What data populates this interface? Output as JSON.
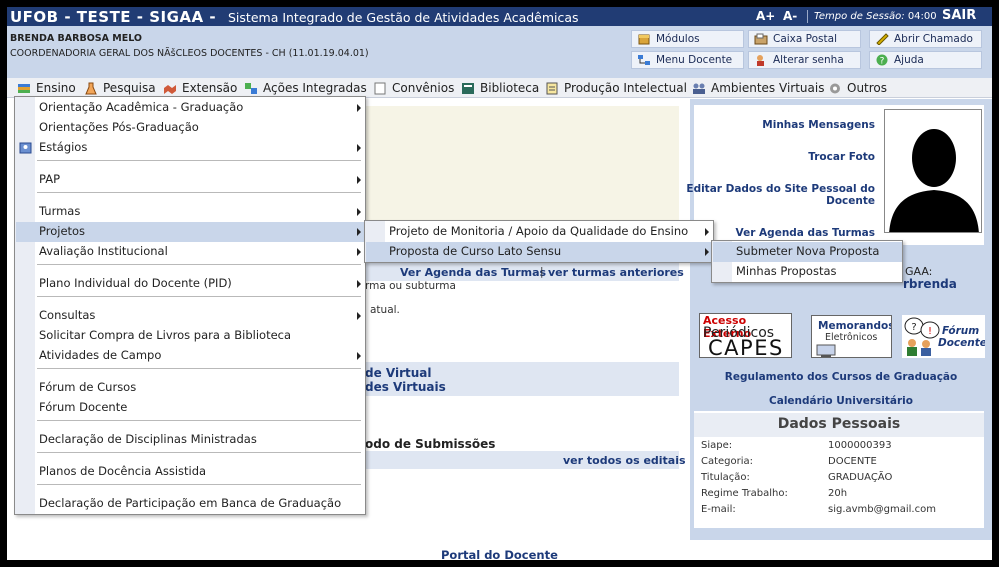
{
  "topbar": {
    "brand": "UFOB - TESTE - SIGAA -",
    "system_name": "Sistema Integrado de Gestão de Atividades Acadêmicas",
    "font_increase": "A+",
    "font_decrease": "A-",
    "session_label": "Tempo de Sessão:",
    "session_time": "04:00",
    "logout": "SAIR"
  },
  "user": {
    "name": "BRENDA BARBOSA MELO",
    "unit": "COORDENADORIA GERAL DOS NÃšCLEOS DOCENTES - CH (11.01.19.04.01)"
  },
  "shortcuts": {
    "modulos": "Módulos",
    "caixa_postal": "Caixa Postal",
    "abrir_chamado": "Abrir Chamado",
    "menu_docente": "Menu Docente",
    "alterar_senha": "Alterar senha",
    "ajuda": "Ajuda"
  },
  "menu": {
    "ensino": "Ensino",
    "pesquisa": "Pesquisa",
    "extensao": "Extensão",
    "acoes": "Ações Integradas",
    "convenios": "Convênios",
    "biblioteca": "Biblioteca",
    "producao": "Produção Intelectual",
    "ambientes": "Ambientes Virtuais",
    "outros": "Outros"
  },
  "ensino_menu": [
    "Orientação Acadêmica - Graduação",
    "Orientações Pós-Graduação",
    "Estágios",
    "PAP",
    "Turmas",
    "Projetos",
    "Avaliação Institucional",
    "Plano Individual do Docente (PID)",
    "Consultas",
    "Solicitar Compra de Livros para a Biblioteca",
    "Atividades de Campo",
    "Fórum de Cursos",
    "Fórum Docente",
    "Declaração de Disciplinas Ministradas",
    "Planos de Docência Assistida",
    "Declaração de Participação em Banca de Graduação"
  ],
  "projetos_menu": [
    "Projeto de Monitoria / Apoio da Qualidade do Ensino",
    "Proposta de Curso Lato Sensu"
  ],
  "lato_menu": [
    "Submeter Nova Proposta",
    "Minhas Propostas"
  ],
  "main": {
    "ver_agenda_turmas": "Ver Agenda das Turmas",
    "ver_turmas_anteriores": "ver turmas anteriores",
    "divider": "|",
    "turma_text": "rma ou subturma",
    "atual_text": "atual.",
    "virtual_1": "de Virtual",
    "virtual_2": "des Virtuais",
    "submissoes": "odo de Submissões",
    "ver_editais": "ver todos os editais"
  },
  "sidebar": {
    "minhas_mensagens": "Minhas Mensagens",
    "trocar_foto": "Trocar Foto",
    "editar_site_1": "Editar Dados do Site Pessoal do",
    "editar_site_2": "Docente",
    "ver_agenda": "Ver Agenda das Turmas",
    "sigaa_label": "GAA:",
    "username": "rbrenda",
    "regulamento": "Regulamento dos Cursos de Graduação",
    "calendario": "Calendário Universitário"
  },
  "banners": {
    "capes_top": "Acesso Externo",
    "capes_mid": "Periódicos",
    "capes_big": "CAPES",
    "memorandos_1": "Memorandos",
    "memorandos_2": "Eletrônicos",
    "forum_1": "Fórum",
    "forum_2": "Docente"
  },
  "dados_pessoais": {
    "title": "Dados Pessoais",
    "rows": [
      {
        "label": "Siape:",
        "value": "1000000393"
      },
      {
        "label": "Categoria:",
        "value": "DOCENTE"
      },
      {
        "label": "Titulação:",
        "value": "GRADUAÇÃO"
      },
      {
        "label": "Regime Trabalho:",
        "value": "20h"
      },
      {
        "label": "E-mail:",
        "value": "sig.avmb@gmail.com"
      }
    ]
  },
  "footer": {
    "portal": "Portal do Docente"
  },
  "colors": {
    "header_navy": "#213c74",
    "link_blue": "#1d3a7a",
    "light_blue": "#c9d6ea"
  }
}
